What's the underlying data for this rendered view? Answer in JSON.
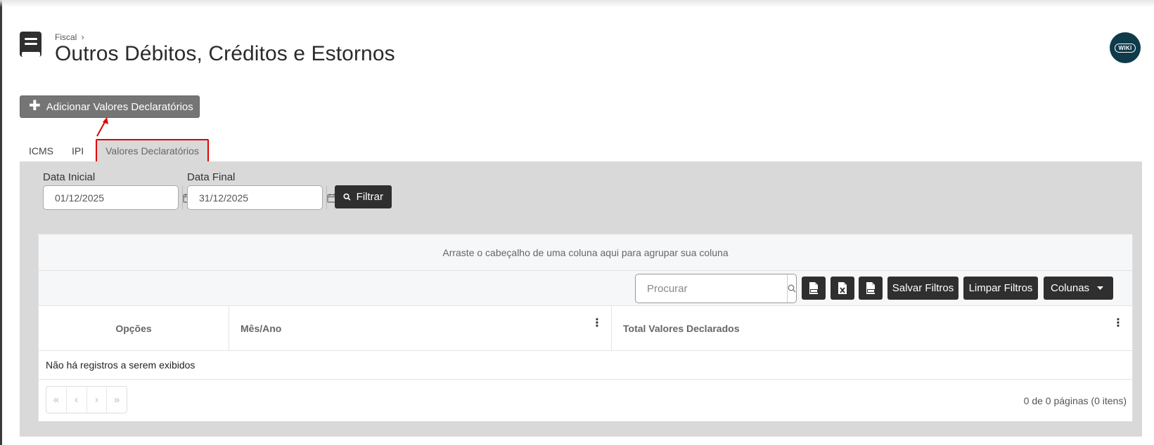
{
  "header": {
    "breadcrumb": "Fiscal",
    "breadcrumb_sep": "›",
    "title": "Outros Débitos, Créditos e Estornos",
    "wiki_label": "WIKI"
  },
  "add_button": {
    "label": "Adicionar Valores Declaratórios",
    "icon": "plus-icon"
  },
  "tabs": [
    {
      "label": "ICMS",
      "active": false
    },
    {
      "label": "IPI",
      "active": false
    },
    {
      "label": "Valores Declaratórios",
      "active": true
    }
  ],
  "filters": {
    "start_label": "Data Inicial",
    "start_value": "01/12/2025",
    "end_label": "Data Final",
    "end_value": "31/12/2025",
    "filter_button": "Filtrar"
  },
  "grid": {
    "group_hint": "Arraste o cabeçalho de uma coluna aqui para agrupar sua coluna",
    "search_placeholder": "Procurar",
    "save_filters": "Salvar Filtros",
    "clear_filters": "Limpar Filtros",
    "columns_button": "Colunas",
    "columns": [
      {
        "label": "Opções"
      },
      {
        "label": "Mês/Ano"
      },
      {
        "label": "Total Valores Declarados"
      }
    ],
    "empty_message": "Não há registros a serem exibidos",
    "pager": {
      "first": "«",
      "prev": "‹",
      "next": "›",
      "last": "»"
    },
    "page_info": "0 de 0 páginas (0 itens)"
  },
  "colors": {
    "dark_button": "#2f2f2f",
    "panel_bg": "#d9d9d9",
    "highlight": "#e00000",
    "wiki_bg": "#0f3b4a"
  }
}
